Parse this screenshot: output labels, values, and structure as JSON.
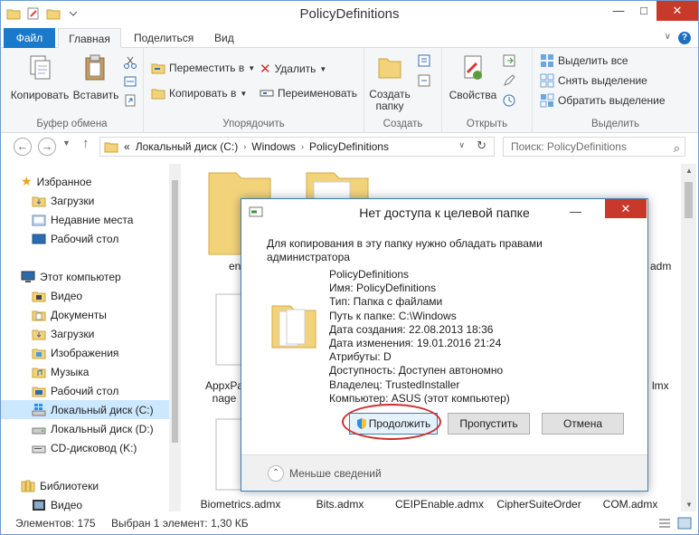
{
  "window": {
    "title": "PolicyDefinitions",
    "minimize": "—",
    "maximize": "□",
    "close": "✕"
  },
  "tabs": {
    "file": "Файл",
    "home": "Главная",
    "share": "Поделиться",
    "view": "Вид"
  },
  "ribbon": {
    "copy": "Копировать",
    "paste": "Вставить",
    "clipboard_group": "Буфер обмена",
    "move_to": "Переместить в",
    "copy_to": "Копировать в",
    "delete": "Удалить",
    "rename": "Переименовать",
    "organize_group": "Упорядочить",
    "new_folder_line1": "Создать",
    "new_folder_line2": "папку",
    "create_group": "Создать",
    "properties": "Свойства",
    "open_group": "Открыть",
    "select_all": "Выделить все",
    "select_none": "Снять выделение",
    "invert_selection": "Обратить выделение",
    "select_group": "Выделить"
  },
  "address": {
    "prefix": "«",
    "crumb1": "Локальный диск (C:)",
    "crumb2": "Windows",
    "crumb3": "PolicyDefinitions",
    "search_placeholder": "Поиск: PolicyDefinitions"
  },
  "nav": {
    "favorites": "Избранное",
    "downloads": "Загрузки",
    "recent": "Недавние места",
    "desktop": "Рабочий стол",
    "this_pc": "Этот компьютер",
    "video": "Видео",
    "documents": "Документы",
    "downloads2": "Загрузки",
    "pictures": "Изображения",
    "music": "Музыка",
    "desktop2": "Рабочий стол",
    "disk_c": "Локальный диск (C:)",
    "disk_d": "Локальный диск (D:)",
    "cd": "CD-дисковод (K:)",
    "libraries": "Библиотеки",
    "video2": "Видео"
  },
  "files": {
    "f1_partial": "en",
    "f2_partial": "adm",
    "appx_line1": "AppxPa",
    "appx_line2": "nage",
    "right_partial": "lmx",
    "bottom": [
      "Biometrics.admx",
      "Bits.admx",
      "CEIPEnable.admx",
      "CipherSuiteOrder",
      "COM.admx"
    ]
  },
  "status": {
    "count": "Элементов: 175",
    "selected": "Выбран 1 элемент: 1,30 КБ"
  },
  "dialog": {
    "title": "Нет доступа к целевой папке",
    "message": "Для копирования в эту папку нужно обладать правами администратора",
    "folder_name": "PolicyDefinitions",
    "name_line": "Имя: PolicyDefinitions",
    "type_line": "Тип: Папка с файлами",
    "path_line": "Путь к папке: C:\\Windows",
    "created_line": "Дата создания: 22.08.2013 18:36",
    "modified_line": "Дата изменения: 19.01.2016 21:24",
    "attrs_line": "Атрибуты: D",
    "availability_line": "Доступность: Доступен автономно",
    "owner_line": "Владелец: TrustedInstaller",
    "computer_line": "Компьютер: ASUS (этот компьютер)",
    "continue": "Продолжить",
    "skip": "Пропустить",
    "cancel": "Отмена",
    "less_details": "Меньше сведений"
  },
  "colors": {
    "accent": "#1979ca",
    "highlight": "#cce8ff",
    "close": "#c7392b",
    "annotation": "#d02d2d",
    "folder": "#f3d37a"
  }
}
